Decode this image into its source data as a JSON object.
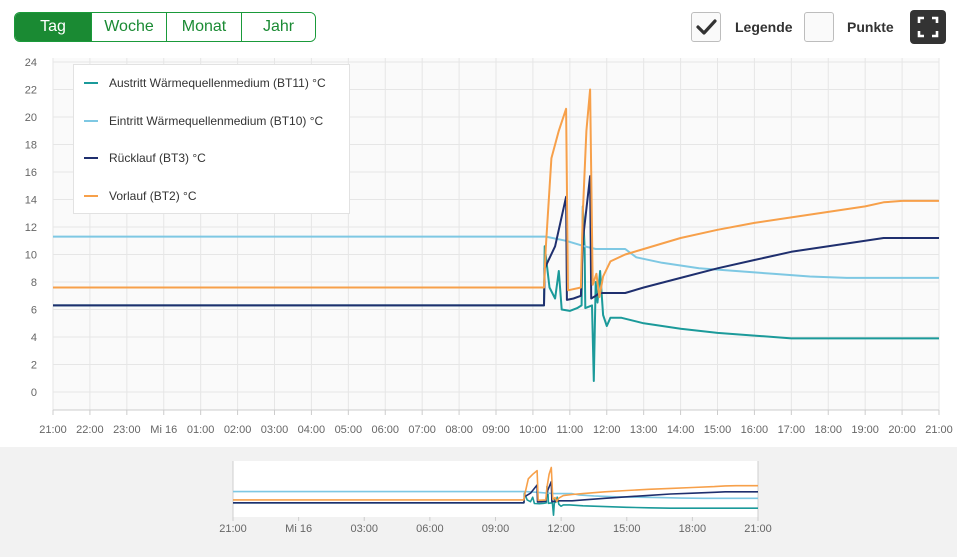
{
  "period_tabs": [
    {
      "label": "Tag",
      "active": true
    },
    {
      "label": "Woche",
      "active": false
    },
    {
      "label": "Monat",
      "active": false
    },
    {
      "label": "Jahr",
      "active": false
    }
  ],
  "options": {
    "legend_label": "Legende",
    "legend_checked": true,
    "points_label": "Punkte",
    "points_checked": false
  },
  "fullscreen_icon": "fullscreen-icon",
  "colors": {
    "accent": "#1a8a33",
    "bt11": "#1b9a9a",
    "bt10": "#7ec8e3",
    "bt3": "#1f2f6e",
    "bt2": "#f7a04a"
  },
  "chart_data": {
    "type": "line",
    "x_unit": "hour since 21:00 previous day",
    "xlim": [
      0,
      24
    ],
    "ylim": [
      -1,
      24
    ],
    "yticks": [
      0,
      2,
      4,
      6,
      8,
      10,
      12,
      14,
      16,
      18,
      20,
      22,
      24
    ],
    "xtick_labels": [
      "21:00",
      "22:00",
      "23:00",
      "Mi 16",
      "01:00",
      "02:00",
      "03:00",
      "04:00",
      "05:00",
      "06:00",
      "07:00",
      "08:00",
      "09:00",
      "10:00",
      "11:00",
      "12:00",
      "13:00",
      "14:00",
      "15:00",
      "16:00",
      "17:00",
      "18:00",
      "19:00",
      "20:00",
      "21:00"
    ],
    "grid": true,
    "legend_position": "top-left",
    "series": [
      {
        "name": "Austritt Wärmequellenmedium (BT11) °C",
        "color": "#1b9a9a",
        "points": [
          [
            0,
            6.3
          ],
          [
            13.3,
            6.3
          ],
          [
            13.32,
            10.6
          ],
          [
            13.45,
            7.6
          ],
          [
            13.6,
            6.8
          ],
          [
            13.7,
            8.8
          ],
          [
            13.78,
            6.0
          ],
          [
            14.0,
            5.9
          ],
          [
            14.2,
            6.1
          ],
          [
            14.32,
            6.3
          ],
          [
            14.35,
            13.5
          ],
          [
            14.4,
            10.5
          ],
          [
            14.42,
            6.1
          ],
          [
            14.6,
            6.3
          ],
          [
            14.65,
            0.8
          ],
          [
            14.7,
            8.0
          ],
          [
            14.75,
            6.5
          ],
          [
            14.82,
            8.8
          ],
          [
            14.9,
            5.6
          ],
          [
            15.0,
            4.8
          ],
          [
            15.1,
            5.4
          ],
          [
            15.4,
            5.4
          ],
          [
            16.0,
            5.0
          ],
          [
            17.0,
            4.6
          ],
          [
            18.0,
            4.3
          ],
          [
            19.0,
            4.1
          ],
          [
            20.0,
            3.9
          ],
          [
            21.0,
            3.9
          ],
          [
            22.0,
            3.9
          ],
          [
            23.0,
            3.9
          ],
          [
            24.0,
            3.9
          ]
        ]
      },
      {
        "name": "Eintritt Wärmequellenmedium (BT10) °C",
        "color": "#7ec8e3",
        "points": [
          [
            0,
            11.3
          ],
          [
            13.35,
            11.3
          ],
          [
            13.9,
            11.0
          ],
          [
            14.4,
            10.6
          ],
          [
            14.7,
            10.4
          ],
          [
            15.5,
            10.4
          ],
          [
            15.8,
            9.8
          ],
          [
            16.5,
            9.4
          ],
          [
            17.5,
            9.0
          ],
          [
            18.5,
            8.8
          ],
          [
            19.5,
            8.6
          ],
          [
            20.5,
            8.4
          ],
          [
            21.5,
            8.3
          ],
          [
            22.5,
            8.3
          ],
          [
            24.0,
            8.3
          ]
        ]
      },
      {
        "name": "Rücklauf (BT3) °C",
        "color": "#1f2f6e",
        "points": [
          [
            0,
            6.3
          ],
          [
            13.3,
            6.3
          ],
          [
            13.32,
            9.0
          ],
          [
            13.6,
            10.6
          ],
          [
            13.9,
            14.2
          ],
          [
            13.92,
            6.7
          ],
          [
            14.1,
            6.8
          ],
          [
            14.3,
            7.0
          ],
          [
            14.35,
            11.0
          ],
          [
            14.55,
            15.7
          ],
          [
            14.58,
            6.8
          ],
          [
            14.7,
            7.0
          ],
          [
            14.8,
            7.2
          ],
          [
            15.5,
            7.2
          ],
          [
            16.0,
            7.6
          ],
          [
            17.0,
            8.3
          ],
          [
            18.0,
            9.0
          ],
          [
            19.0,
            9.6
          ],
          [
            20.0,
            10.2
          ],
          [
            21.0,
            10.6
          ],
          [
            22.0,
            11.0
          ],
          [
            22.5,
            11.2
          ],
          [
            24.0,
            11.2
          ]
        ]
      },
      {
        "name": "Vorlauf (BT2) °C",
        "color": "#f7a04a",
        "points": [
          [
            0,
            7.6
          ],
          [
            13.3,
            7.6
          ],
          [
            13.35,
            10.5
          ],
          [
            13.5,
            17.0
          ],
          [
            13.7,
            19.0
          ],
          [
            13.9,
            20.6
          ],
          [
            13.95,
            7.4
          ],
          [
            14.3,
            7.6
          ],
          [
            14.35,
            13.0
          ],
          [
            14.45,
            19.0
          ],
          [
            14.55,
            22.0
          ],
          [
            14.62,
            7.8
          ],
          [
            14.72,
            8.6
          ],
          [
            14.8,
            6.9
          ],
          [
            14.9,
            8.4
          ],
          [
            15.1,
            9.5
          ],
          [
            15.5,
            10.0
          ],
          [
            16.0,
            10.4
          ],
          [
            16.5,
            10.8
          ],
          [
            17.0,
            11.2
          ],
          [
            18.0,
            11.8
          ],
          [
            19.0,
            12.3
          ],
          [
            20.0,
            12.7
          ],
          [
            21.0,
            13.1
          ],
          [
            22.0,
            13.5
          ],
          [
            22.5,
            13.8
          ],
          [
            23.0,
            13.9
          ],
          [
            24.0,
            13.9
          ]
        ]
      }
    ]
  },
  "navigator": {
    "xtick_labels": [
      "21:00",
      "Mi 16",
      "03:00",
      "06:00",
      "09:00",
      "12:00",
      "15:00",
      "18:00",
      "21:00"
    ]
  }
}
